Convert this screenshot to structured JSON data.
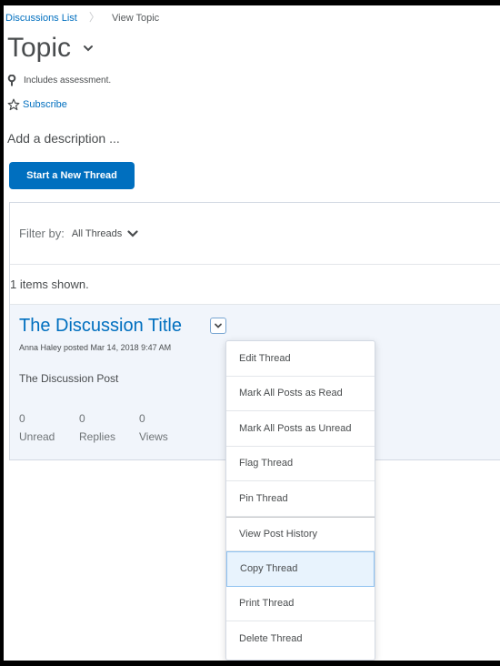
{
  "breadcrumb": {
    "parent": "Discussions List",
    "current": "View Topic"
  },
  "topic": {
    "title": "Topic",
    "assessment_note": "Includes assessment.",
    "subscribe": "Subscribe",
    "description_placeholder": "Add a description ..."
  },
  "buttons": {
    "new_thread": "Start a New Thread"
  },
  "filter": {
    "label": "Filter by:",
    "value": "All Threads"
  },
  "items_shown": "1 items shown.",
  "thread": {
    "title": "The Discussion Title",
    "meta": "Anna Haley posted Mar 14, 2018 9:47 AM",
    "post": "The Discussion Post",
    "stats": [
      {
        "value": "0",
        "label": "Unread"
      },
      {
        "value": "0",
        "label": "Replies"
      },
      {
        "value": "0",
        "label": "Views"
      }
    ]
  },
  "menu": {
    "items": [
      "Edit Thread",
      "Mark All Posts as Read",
      "Mark All Posts as Unread",
      "Flag Thread",
      "Pin Thread",
      "View Post History",
      "Copy Thread",
      "Print Thread",
      "Delete Thread"
    ],
    "selected_index": 6
  },
  "colors": {
    "link": "#006fbf",
    "button": "#006fbf",
    "thread_bg": "#f1f5fb",
    "menu_selected": "#e8f3fd"
  }
}
